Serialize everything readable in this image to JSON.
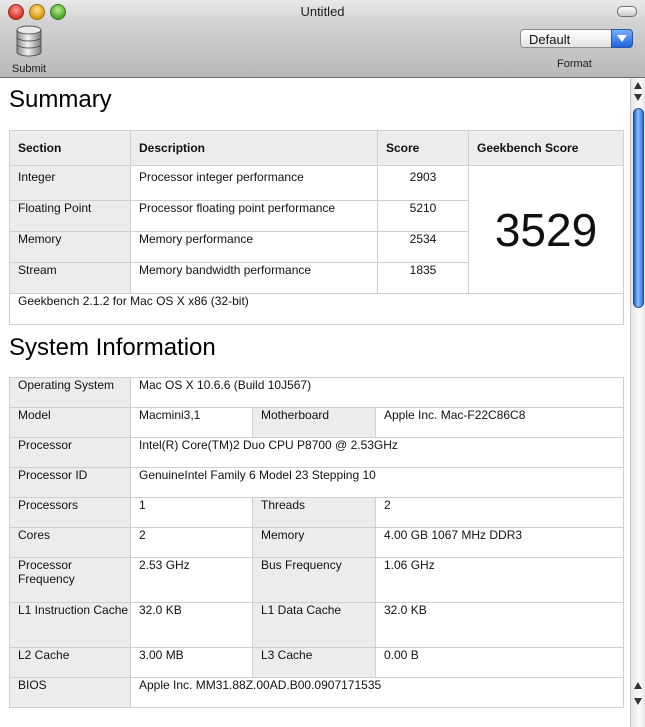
{
  "window": {
    "title": "Untitled"
  },
  "toolbar": {
    "submit_label": "Submit",
    "format_label": "Format",
    "format_value": "Default"
  },
  "summary": {
    "heading": "Summary",
    "headers": [
      "Section",
      "Description",
      "Score",
      "Geekbench Score"
    ],
    "rows": [
      {
        "section": "Integer",
        "description": "Processor integer performance",
        "score": "2903"
      },
      {
        "section": "Floating Point",
        "description": "Processor floating point performance",
        "score": "5210"
      },
      {
        "section": "Memory",
        "description": "Memory performance",
        "score": "2534"
      },
      {
        "section": "Stream",
        "description": "Memory bandwidth performance",
        "score": "1835"
      }
    ],
    "geekbench_score": "3529",
    "footer": "Geekbench 2.1.2 for Mac OS X x86 (32-bit)"
  },
  "system": {
    "heading": "System Information",
    "operating_system": {
      "label": "Operating System",
      "value": "Mac OS X 10.6.6 (Build 10J567)"
    },
    "model": {
      "label": "Model",
      "value": "Macmini3,1"
    },
    "motherboard": {
      "label": "Motherboard",
      "value": "Apple Inc. Mac-F22C86C8"
    },
    "processor": {
      "label": "Processor",
      "value": "Intel(R) Core(TM)2 Duo CPU P8700 @ 2.53GHz"
    },
    "processor_id": {
      "label": "Processor ID",
      "value": "GenuineIntel Family 6 Model 23 Stepping 10"
    },
    "processors": {
      "label": "Processors",
      "value": "1"
    },
    "threads": {
      "label": "Threads",
      "value": "2"
    },
    "cores": {
      "label": "Cores",
      "value": "2"
    },
    "memory": {
      "label": "Memory",
      "value": "4.00 GB  1067 MHz DDR3"
    },
    "processor_frequency": {
      "label": "Processor Frequency",
      "value": "2.53 GHz"
    },
    "bus_frequency": {
      "label": "Bus Frequency",
      "value": "1.06 GHz"
    },
    "l1_instruction_cache": {
      "label": "L1 Instruction Cache",
      "value": "32.0 KB"
    },
    "l1_data_cache": {
      "label": "L1 Data Cache",
      "value": "32.0 KB"
    },
    "l2_cache": {
      "label": "L2 Cache",
      "value": "3.00 MB"
    },
    "l3_cache": {
      "label": "L3 Cache",
      "value": "0.00 B"
    },
    "bios": {
      "label": "BIOS",
      "value": "Apple Inc. MM31.88Z.00AD.B00.0907171535"
    }
  }
}
